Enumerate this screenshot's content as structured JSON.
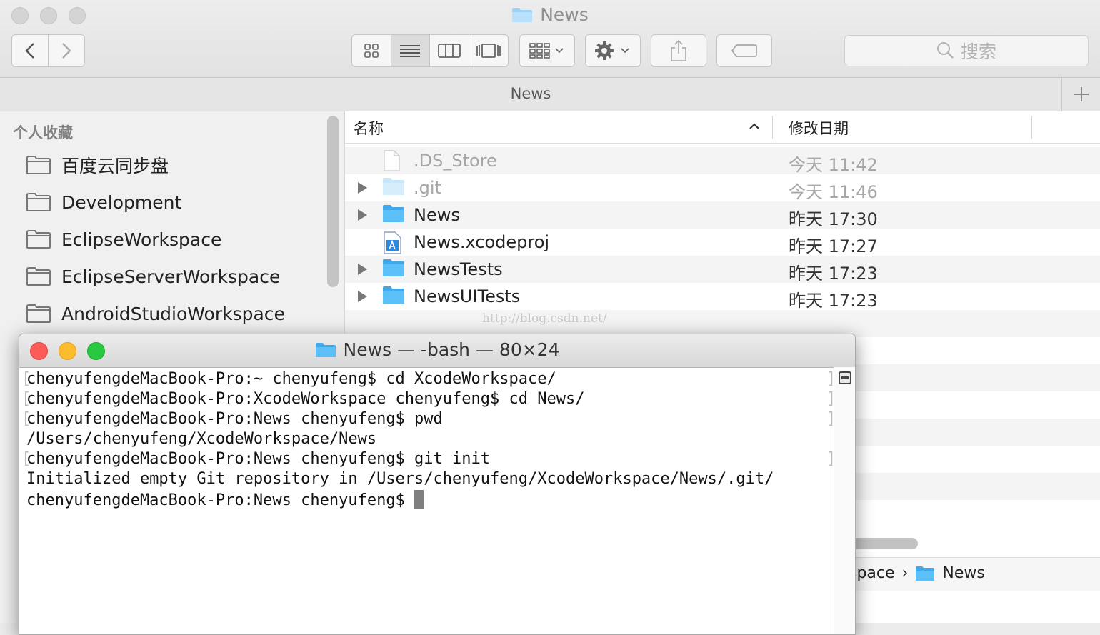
{
  "finder": {
    "window_title": "News",
    "tab_label": "News",
    "search_placeholder": "搜索",
    "sidebar": {
      "header": "个人收藏",
      "items": [
        {
          "label": "百度云同步盘"
        },
        {
          "label": "Development"
        },
        {
          "label": "EclipseWorkspace"
        },
        {
          "label": "EclipseServerWorkspace"
        },
        {
          "label": "AndroidStudioWorkspace"
        }
      ]
    },
    "columns": {
      "name": "名称",
      "date": "修改日期"
    },
    "files": [
      {
        "name": ".DS_Store",
        "date": "今天 11:42",
        "kind": "file",
        "expandable": false,
        "dimmed": true
      },
      {
        "name": ".git",
        "date": "今天 11:46",
        "kind": "folder",
        "expandable": true,
        "dimmed": true
      },
      {
        "name": "News",
        "date": "昨天 17:30",
        "kind": "folder",
        "expandable": true,
        "dimmed": false
      },
      {
        "name": "News.xcodeproj",
        "date": "昨天 17:27",
        "kind": "xcodeproj",
        "expandable": false,
        "dimmed": false
      },
      {
        "name": "NewsTests",
        "date": "昨天 17:23",
        "kind": "folder",
        "expandable": true,
        "dimmed": false
      },
      {
        "name": "NewsUITests",
        "date": "昨天 17:23",
        "kind": "folder",
        "expandable": true,
        "dimmed": false
      }
    ],
    "watermark": "http://blog.csdn.net/",
    "path": {
      "partial": "space",
      "separator": "›",
      "current": "News"
    }
  },
  "terminal": {
    "title": "News — -bash — 80×24",
    "lines": [
      {
        "text": "chenyufengdeMacBook-Pro:~ chenyufeng$ cd XcodeWorkspace/",
        "marked": true
      },
      {
        "text": "chenyufengdeMacBook-Pro:XcodeWorkspace chenyufeng$ cd News/",
        "marked": true
      },
      {
        "text": "chenyufengdeMacBook-Pro:News chenyufeng$ pwd",
        "marked": true
      },
      {
        "text": "/Users/chenyufeng/XcodeWorkspace/News",
        "marked": false
      },
      {
        "text": "chenyufengdeMacBook-Pro:News chenyufeng$ git init",
        "marked": true
      },
      {
        "text": "Initialized empty Git repository in /Users/chenyufeng/XcodeWorkspace/News/.git/",
        "marked": false
      },
      {
        "text": "chenyufengdeMacBook-Pro:News chenyufeng$ ",
        "marked": false,
        "cursor": true
      }
    ]
  },
  "colors": {
    "traffic_red": "#fc5b57",
    "traffic_yellow": "#fdbc2e",
    "traffic_green": "#28c840",
    "folder_blue": "#5bc0f8"
  },
  "icons": [
    "back-chevron-icon",
    "forward-chevron-icon",
    "icon-view-icon",
    "list-view-icon",
    "column-view-icon",
    "coverflow-view-icon",
    "arrange-icon",
    "gear-icon",
    "share-icon",
    "tag-icon",
    "search-icon",
    "plus-icon",
    "folder-icon",
    "file-icon",
    "xcodeproj-icon",
    "disclosure-triangle-icon"
  ]
}
